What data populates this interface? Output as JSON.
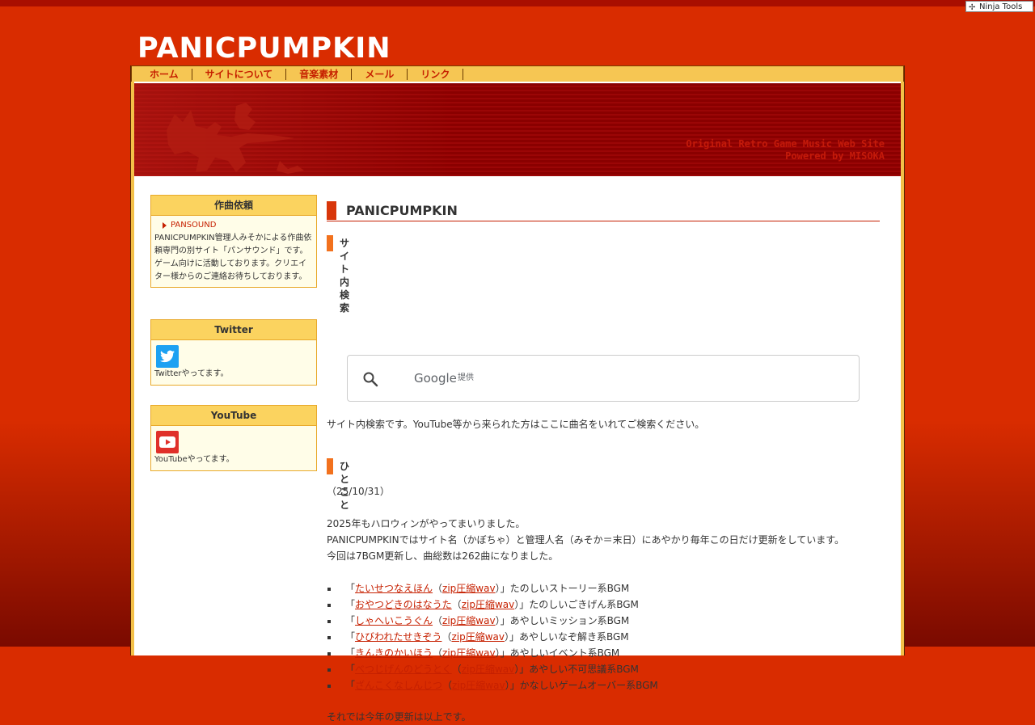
{
  "toolbar": {
    "ninja_tools": "Ninja Tools"
  },
  "site": {
    "title": "PANICPUMPKIN",
    "tagline_1": "Original Retro Game Music Web Site",
    "tagline_2": "Powered by MISOKA"
  },
  "nav": {
    "items": [
      {
        "label": "ホーム"
      },
      {
        "label": "サイトについて"
      },
      {
        "label": "音楽素材"
      },
      {
        "label": "メール"
      },
      {
        "label": "リンク"
      }
    ]
  },
  "sidebar": {
    "commission": {
      "title": "作曲依頼",
      "link": "PANSOUND",
      "text": "PANICPUMPKIN管理人みそかによる作曲依頼専門の別サイト「パンサウンド」です。ゲーム向けに活動しております。クリエイター様からのご連絡お待ちしております。"
    },
    "twitter": {
      "title": "Twitter",
      "text": "Twitterやってます。",
      "icon": "twitter-bird-icon"
    },
    "youtube": {
      "title": "YouTube",
      "text": "YouTubeやってます。",
      "icon": "youtube-play-icon"
    }
  },
  "main": {
    "heading": "PANICPUMPKIN",
    "search_section": {
      "heading": "サイト内検索",
      "google": "Google",
      "provided": "提供",
      "description": "サイト内検索です。YouTube等から来られた方はここに曲名をいれてご検索ください。"
    },
    "news": {
      "heading": "ひとこと",
      "date": "（25/10/31）",
      "line1": "2025年もハロウィンがやってまいりました。",
      "line2": "PANICPUMPKINではサイト名（かぼちゃ）と管理人名（みそか＝末日）にあやかり毎年この日だけ更新をしています。",
      "line3": "今回は7BGM更新し、曲総数は262曲になりました。",
      "tracks": [
        {
          "title": "たいせつなえほん",
          "download": "zip圧縮wav",
          "desc": "たのしいストーリー系BGM"
        },
        {
          "title": "おやつどきのはなうた",
          "download": "zip圧縮wav",
          "desc": "たのしいごきげん系BGM"
        },
        {
          "title": "しゃへいこうぐん",
          "download": "zip圧縮wav",
          "desc": "あやしいミッション系BGM"
        },
        {
          "title": "ひびわれたせきぞう",
          "download": "zip圧縮wav",
          "desc": "あやしいなぞ解き系BGM"
        },
        {
          "title": "きんきのかいほう",
          "download": "zip圧縮wav",
          "desc": "あやしいイベント系BGM"
        },
        {
          "title": "べつじげんのどうとく",
          "download": "zip圧縮wav",
          "desc": "あやしい不可思議系BGM"
        },
        {
          "title": "ざんこくなしんじつ",
          "download": "zip圧縮wav",
          "desc": "かなしいゲームオーバー系BGM"
        }
      ],
      "closing": "それでは今年の更新は以上です。"
    }
  },
  "colors": {
    "accent": "#c62000",
    "background": "#d92c00",
    "nav": "#f6c653",
    "banner": "#8a0000"
  }
}
